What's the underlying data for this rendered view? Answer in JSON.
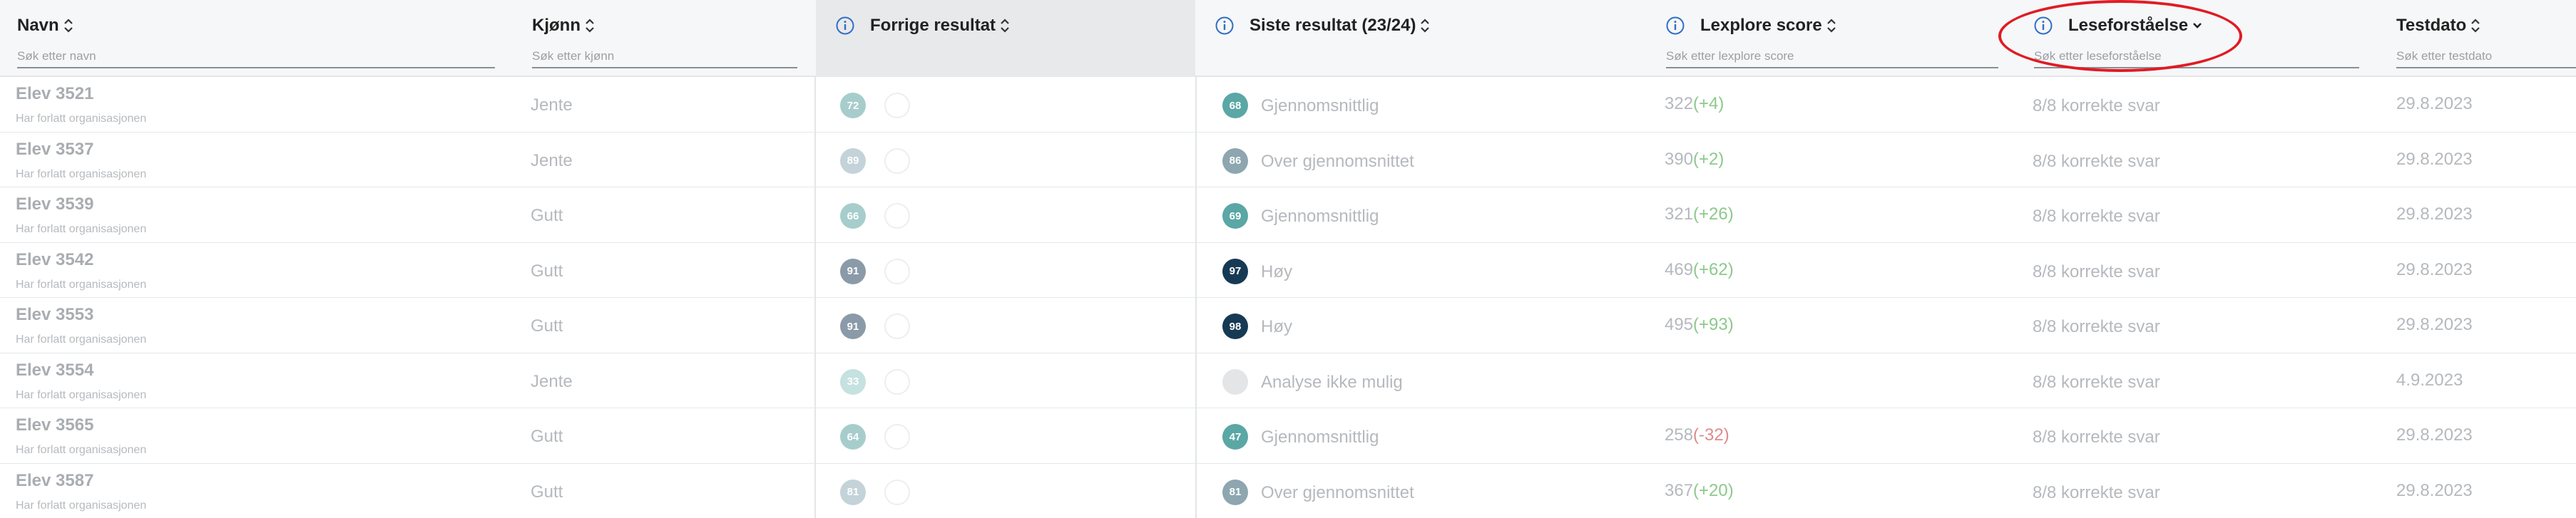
{
  "header": {
    "navn": {
      "label": "Navn",
      "placeholder": "Søk etter navn"
    },
    "kjonn": {
      "label": "Kjønn",
      "placeholder": "Søk etter kjønn"
    },
    "forrige": {
      "label": "Forrige resultat"
    },
    "siste": {
      "label": "Siste resultat (23/24)"
    },
    "lexplore": {
      "label": "Lexplore score",
      "placeholder": "Søk etter lexplore score"
    },
    "lese": {
      "label": "Leseforståelse",
      "placeholder": "Søk etter leseforståelse"
    },
    "testdato": {
      "label": "Testdato",
      "placeholder": "Søk etter testdato"
    }
  },
  "colors": {
    "teal_light": "#a6cdcc",
    "teal": "#5aa7a5",
    "slate": "#8a9aa8",
    "slate_light": "#9fb2ba",
    "navy": "#173a54",
    "grey_empty": "#e3e5e7",
    "highlight": "#e01b24"
  },
  "rows": [
    {
      "name": "Elev 3521",
      "status": "Har forlatt organisasjonen",
      "gender": "Jente",
      "prev": "72",
      "prev_color": "#a6cdcc",
      "cur": "68",
      "cur_color": "#5aa7a5",
      "cur_label": "Gjennomsnittlig",
      "score": "322",
      "delta": "(+4)",
      "delta_sign": "pos",
      "lese": "8/8 korrekte svar",
      "date": "29.8.2023"
    },
    {
      "name": "Elev 3537",
      "status": "Har forlatt organisasjonen",
      "gender": "Jente",
      "prev": "89",
      "prev_color": "#c3d3d9",
      "cur": "86",
      "cur_color": "#8da6b0",
      "cur_label": "Over gjennomsnittet",
      "score": "390",
      "delta": "(+2)",
      "delta_sign": "pos",
      "lese": "8/8 korrekte svar",
      "date": "29.8.2023"
    },
    {
      "name": "Elev 3539",
      "status": "Har forlatt organisasjonen",
      "gender": "Gutt",
      "prev": "66",
      "prev_color": "#a6cdcc",
      "cur": "69",
      "cur_color": "#5aa7a5",
      "cur_label": "Gjennomsnittlig",
      "score": "321",
      "delta": "(+26)",
      "delta_sign": "pos",
      "lese": "8/8 korrekte svar",
      "date": "29.8.2023"
    },
    {
      "name": "Elev 3542",
      "status": "Har forlatt organisasjonen",
      "gender": "Gutt",
      "prev": "91",
      "prev_color": "#8a9aa8",
      "cur": "97",
      "cur_color": "#173a54",
      "cur_label": "Høy",
      "score": "469",
      "delta": "(+62)",
      "delta_sign": "pos",
      "lese": "8/8 korrekte svar",
      "date": "29.8.2023"
    },
    {
      "name": "Elev 3553",
      "status": "Har forlatt organisasjonen",
      "gender": "Gutt",
      "prev": "91",
      "prev_color": "#8a9aa8",
      "cur": "98",
      "cur_color": "#173a54",
      "cur_label": "Høy",
      "score": "495",
      "delta": "(+93)",
      "delta_sign": "pos",
      "lese": "8/8 korrekte svar",
      "date": "29.8.2023"
    },
    {
      "name": "Elev 3554",
      "status": "Har forlatt organisasjonen",
      "gender": "Jente",
      "prev": "33",
      "prev_color": "#c5e1e0",
      "cur": "",
      "cur_color": "#e3e5e7",
      "cur_label": "Analyse ikke mulig",
      "score": "",
      "delta": "",
      "delta_sign": "pos",
      "lese": "8/8 korrekte svar",
      "date": "4.9.2023"
    },
    {
      "name": "Elev 3565",
      "status": "Har forlatt organisasjonen",
      "gender": "Gutt",
      "prev": "64",
      "prev_color": "#a6cdcc",
      "cur": "47",
      "cur_color": "#5aa7a5",
      "cur_label": "Gjennomsnittlig",
      "score": "258",
      "delta": "(-32)",
      "delta_sign": "neg",
      "lese": "8/8 korrekte svar",
      "date": "29.8.2023"
    },
    {
      "name": "Elev 3587",
      "status": "Har forlatt organisasjonen",
      "gender": "Gutt",
      "prev": "81",
      "prev_color": "#c3d3d9",
      "cur": "81",
      "cur_color": "#8da6b0",
      "cur_label": "Over gjennomsnittet",
      "score": "367",
      "delta": "(+20)",
      "delta_sign": "pos",
      "lese": "8/8 korrekte svar",
      "date": "29.8.2023"
    }
  ]
}
